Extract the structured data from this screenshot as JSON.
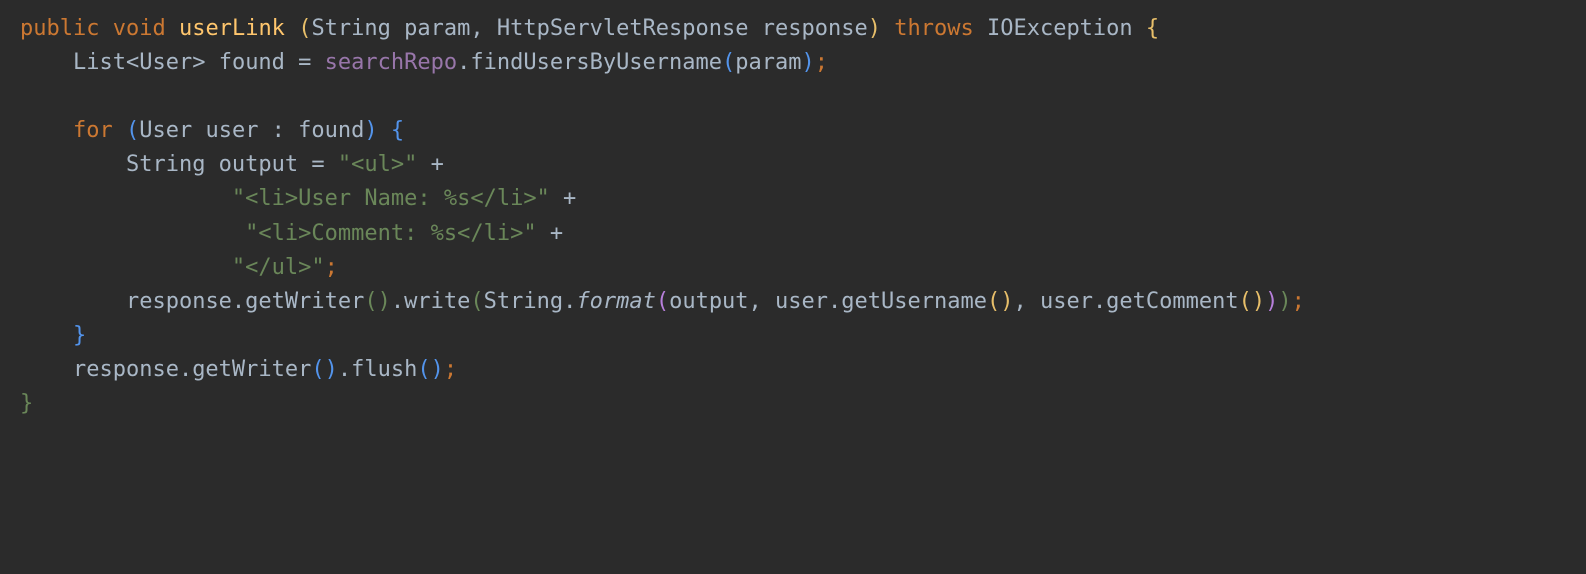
{
  "code": {
    "line1": {
      "kw_public": "public",
      "kw_void": "void",
      "method": "userLink",
      "sp1": " ",
      "paren_open": "(",
      "params": "String param, HttpServletResponse response",
      "paren_close": ")",
      "kw_throws": "throws",
      "exc": "IOException",
      "brace_open": "{"
    },
    "line2": {
      "indent": "    ",
      "type1": "List",
      "lt": "<",
      "type2": "User",
      "gt": ">",
      "var": " found ",
      "eq": "=",
      "sp": " ",
      "field": "searchRepo",
      "call": ".findUsersByUsername",
      "po": "(",
      "arg": "param",
      "pc": ")",
      "semi": ";"
    },
    "line3": {
      "blank": " "
    },
    "line4": {
      "indent": "    ",
      "kw_for": "for",
      "po": "(",
      "decl": "User user : found",
      "pc": ")",
      "brace": "{"
    },
    "line5": {
      "indent": "        ",
      "decl": "String output ",
      "eq": "=",
      "sp": " ",
      "str": "\"<ul>\"",
      "plus": " +"
    },
    "line6": {
      "indent": "                ",
      "str": "\"<li>User Name: %s</li>\"",
      "plus": " +"
    },
    "line7": {
      "indent": "                 ",
      "str": "\"<li>Comment: %s</li>\"",
      "plus": " +"
    },
    "line8": {
      "indent": "                ",
      "str": "\"</ul>\"",
      "semi": ";"
    },
    "line9": {
      "indent": "        ",
      "a": "response.getWriter",
      "po1": "(",
      "pc1": ")",
      "b": ".write",
      "po2": "(",
      "c": "String.",
      "fmt": "format",
      "po3": "(",
      "args": "output, user.getUsername",
      "po4": "(",
      "pc4": ")",
      "d": ", user.getComment",
      "po5": "(",
      "pc5": ")",
      "pc3": ")",
      "pc2": ")",
      "semi": ";"
    },
    "line10": {
      "indent": "    ",
      "brace": "}"
    },
    "line11": {
      "indent": "    ",
      "a": "response.getWriter",
      "po1": "(",
      "pc1": ")",
      "b": ".flush",
      "po2": "(",
      "pc2": ")",
      "semi": ";"
    },
    "line12": {
      "brace": "}"
    }
  }
}
